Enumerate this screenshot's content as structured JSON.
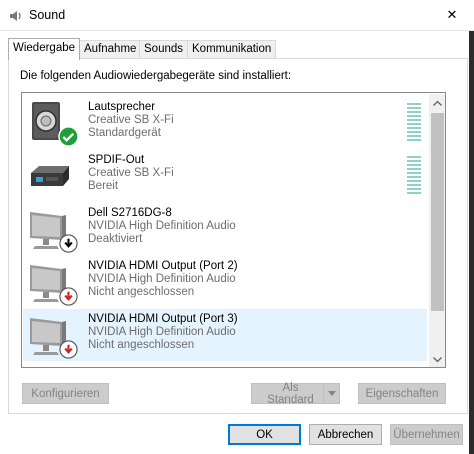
{
  "window": {
    "title": "Sound",
    "close_glyph": "✕"
  },
  "tabs": [
    {
      "label": "Wiedergabe",
      "active": true
    },
    {
      "label": "Aufnahme",
      "active": false
    },
    {
      "label": "Sounds",
      "active": false
    },
    {
      "label": "Kommunikation",
      "active": false
    }
  ],
  "panel": {
    "heading": "Die folgenden Audiowiedergabegeräte sind installiert:"
  },
  "devices": [
    {
      "name": "Lautsprecher",
      "description": "Creative SB X-Fi",
      "status": "Standardgerät",
      "icon": "speaker-icon",
      "badge": "default-check-icon",
      "selected": false,
      "level_meter": true
    },
    {
      "name": "SPDIF-Out",
      "description": "Creative SB X-Fi",
      "status": "Bereit",
      "icon": "digital-output-icon",
      "badge": "",
      "selected": false,
      "level_meter": true
    },
    {
      "name": "Dell S2716DG-8",
      "description": "NVIDIA High Definition Audio",
      "status": "Deaktiviert",
      "icon": "monitor-icon",
      "badge": "disabled-arrow-icon",
      "selected": false,
      "level_meter": false
    },
    {
      "name": "NVIDIA HDMI Output (Port 2)",
      "description": "NVIDIA High Definition Audio",
      "status": "Nicht angeschlossen",
      "icon": "monitor-icon",
      "badge": "unplugged-arrow-icon",
      "selected": false,
      "level_meter": false
    },
    {
      "name": "NVIDIA HDMI Output (Port 3)",
      "description": "NVIDIA High Definition Audio",
      "status": "Nicht angeschlossen",
      "icon": "monitor-icon",
      "badge": "unplugged-arrow-icon",
      "selected": true,
      "level_meter": false
    }
  ],
  "buttons": {
    "configure": "Konfigurieren",
    "set_default": "Als Standard",
    "properties": "Eigenschaften",
    "ok": "OK",
    "cancel": "Abbrechen",
    "apply": "Übernehmen"
  },
  "colors": {
    "selection": "#e5f3ff",
    "accent": "#0078d7",
    "check_green": "#1f9e3a",
    "badge_red": "#d21f1f"
  }
}
